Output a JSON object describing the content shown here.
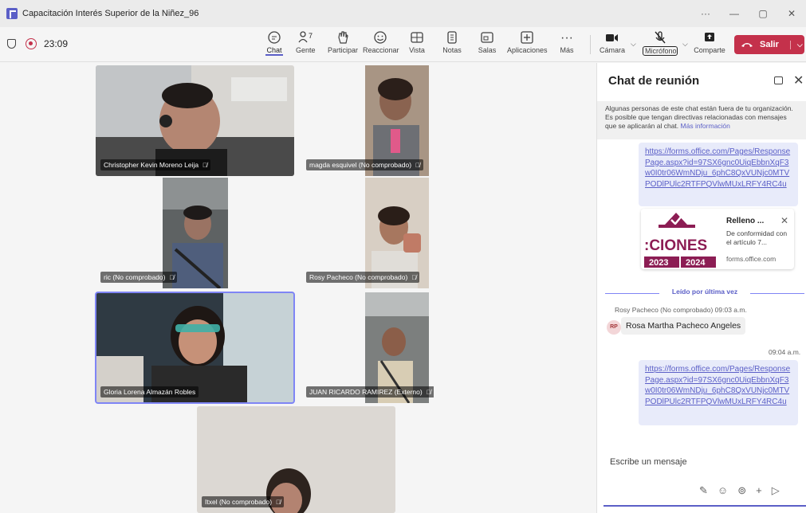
{
  "window": {
    "title": "Capacitación Interés Superior de la Niñez_96",
    "controls": [
      "···",
      "—",
      "▢",
      "✕"
    ]
  },
  "toolbar": {
    "timer": "23:09",
    "buttons": [
      {
        "id": "chat",
        "label": "Chat",
        "icon": "chat-icon"
      },
      {
        "id": "people",
        "label": "Gente",
        "icon": "people-icon",
        "count": "7"
      },
      {
        "id": "raise",
        "label": "Participar",
        "icon": "hand-icon"
      },
      {
        "id": "react",
        "label": "Reaccionar",
        "icon": "smile-icon"
      },
      {
        "id": "view",
        "label": "Vista",
        "icon": "grid-icon"
      },
      {
        "id": "notes",
        "label": "Notas",
        "icon": "notes-icon"
      },
      {
        "id": "rooms",
        "label": "Salas",
        "icon": "rooms-icon"
      },
      {
        "id": "apps",
        "label": "Aplicaciones",
        "icon": "plus-icon"
      },
      {
        "id": "more",
        "label": "Más",
        "icon": "more-icon"
      },
      {
        "id": "camera",
        "label": "Cámara",
        "icon": "camera-icon"
      },
      {
        "id": "mic",
        "label": "Micrófono",
        "icon": "mic-muted-icon"
      },
      {
        "id": "share",
        "label": "Comparte",
        "icon": "share-icon"
      }
    ],
    "leave_label": "Salir"
  },
  "participants": [
    {
      "name": "Christopher Kevin Moreno Leija",
      "muted": true,
      "bg": "#c9c6c0"
    },
    {
      "name": "magda esquivel (No comprobado)",
      "muted": true,
      "bg": "#9c8d80"
    },
    {
      "name": "ric (No comprobado)",
      "muted": true,
      "bg": "#6f7170"
    },
    {
      "name": "Rosy Pacheco (No comprobado)",
      "muted": true,
      "bg": "#c7b9a8"
    },
    {
      "name": "Gloria Lorena Almazán Robles",
      "muted": false,
      "bg": "#3a3a3a"
    },
    {
      "name": "JUAN RICARDO RAMIREZ (Externo)",
      "muted": true,
      "bg": "#8a8d8c"
    },
    {
      "name": "Itxel (No comprobado)",
      "muted": true,
      "bg": "#dad6d1"
    }
  ],
  "chat": {
    "title": "Chat de reunión",
    "notice": "Algunas personas de este chat están fuera de tu organización. Es posible que tengan directivas relacionadas con mensajes que se aplicarán al chat.",
    "notice_link": "Más información",
    "link1": "https://forms.office.com/Pages/ResponsePage.aspx?id=97SX6gnc0UiqEbbnXqF3w0I0tr06WmNDju_6phC8QxVUNjc0MTVPODlPUlc2RTFPQVlwMUxLRFY4RC4u",
    "card": {
      "title": "Relleno ...",
      "description": "De conformidad con el artículo 7...",
      "domain": "forms.office.com",
      "thumb_text_top": ":CIONES",
      "thumb_years": [
        "2023",
        "2024"
      ]
    },
    "last_read": "Leído por última vez",
    "sender": "Rosy Pacheco (No comprobado)  09:03 a.m.",
    "avatar_initials": "RP",
    "received_message": "Rosa Martha Pacheco Angeles",
    "sent_time": "09:04 a.m.",
    "link2": "https://forms.office.com/Pages/ResponsePage.aspx?id=97SX6gnc0UiqEbbnXqF3w0I0tr06WmNDju_6phC8QxVUNjc0MTVPODlPUlc2RTFPQVlwMUxLRFY4RC4u",
    "composer_placeholder": "Escribe un mensaje"
  }
}
